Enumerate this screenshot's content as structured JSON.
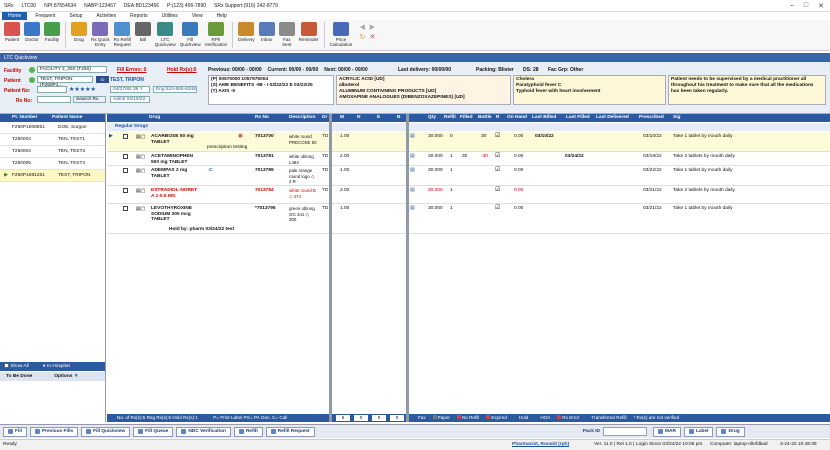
{
  "titlebar": {
    "app": "SRx",
    "store": "LTC00",
    "npi": "NPI:87654634",
    "nabp": "NABP:123467",
    "dea": "DEA:BD123456",
    "phone": "P:(123) 456-7890",
    "support": "SRx Support:(916) 242-8779",
    "min": "–",
    "max": "□",
    "close": "✕"
  },
  "menu": [
    "Home",
    "Frequent",
    "Setup",
    "Activities",
    "Reports",
    "Utilities",
    "View",
    "Help"
  ],
  "ribbon": [
    {
      "label": "Patient",
      "icon": "patient-icon",
      "color": "#d9534f"
    },
    {
      "label": "Doctor",
      "icon": "doctor-icon",
      "color": "#3c78c8"
    },
    {
      "label": "Facility",
      "icon": "facility-icon",
      "color": "#4a9d4a"
    },
    {
      "label": "Drug",
      "icon": "drug-icon",
      "color": "#e0a020"
    },
    {
      "label": "Rx Quick\nEntry",
      "icon": "rx-quick-entry-icon",
      "color": "#7a6bb8"
    },
    {
      "label": "Rx Refill\nRequest",
      "icon": "rx-refill-icon",
      "color": "#4d8fcf"
    },
    {
      "label": "Bill",
      "icon": "bill-icon",
      "color": "#666"
    },
    {
      "label": "LTC\nQuickview",
      "icon": "ltc-quickview-icon",
      "color": "#3a8a8a"
    },
    {
      "label": "Fill\nQuickview",
      "icon": "fill-quickview-icon",
      "color": "#3a7ab8"
    },
    {
      "label": "RPh\nVerification",
      "icon": "verification-icon",
      "color": "#6a9a3a"
    },
    {
      "label": "Delivery",
      "icon": "delivery-icon",
      "color": "#c88a2a"
    },
    {
      "label": "Inbox",
      "icon": "inbox-icon",
      "color": "#5a7ab8"
    },
    {
      "label": "Fax\nSent",
      "icon": "fax-sent-icon",
      "color": "#8a8a8a"
    },
    {
      "label": "Reminder",
      "icon": "reminder-icon",
      "color": "#c85a3a"
    },
    {
      "label": "Price\nCalculation",
      "icon": "price-calculation-icon",
      "color": "#4a6ab8"
    }
  ],
  "window_title": "LTC Quickview",
  "filters": {
    "facility_label": "Facility",
    "facility_value": "FACILITY 2_250 (T250)",
    "fill_errors": "Fill Errors: 0",
    "hold_rxs": "Hold Rx(s):0",
    "patient_label": "Patient",
    "patient_value": "TEST, TRIPON (F250P1...",
    "patient_name": "TEST, TRIPON",
    "patient_no_label": "Patient No:",
    "dob": "04/27/82 39 Y",
    "eng": "Eng 510-555-6346",
    "rx_no_label": "Rx No:",
    "search_rx": "Search Rx",
    "admit": "Admit 03/19/22"
  },
  "summary": {
    "previous": "Previous: 00/00 - 00/00",
    "current": "Current: 00/00 - 00/00",
    "next": "Next: 00/00 - 00/00",
    "last_delivery": "Last delivery:   00/00/00",
    "packing": "Packing: Blister",
    "ds": "DS: 28",
    "fac_grp": "Fac Grp: Other"
  },
  "insurance": [
    "(P) 00670000   1057975004",
    "(S) AME BENEFITS  -98 - I 03/22/22 E 03/22/25",
    "(T) AXIS  -5"
  ],
  "allergies": [
    "ACRYLIC ACID [UD]",
    "albuterol",
    "ALUMINUM CONTAINING PRODUCTS [UD]",
    "AMOXAPINE ANALOGUES (DIBENZOXAZEPINES) [UD]"
  ],
  "conditions": [
    "Cholera",
    "Paratyphoid fever C",
    "Typhoid fever with heart involvement"
  ],
  "note": "Patient needs to be supervised by a medical practitioner all throughout his treatment to make sure that all the medications has been taken regularly.",
  "sidebar": {
    "headers": [
      "Pt. Number",
      "Patient Name"
    ],
    "rows": [
      [
        "F250P1608851",
        "DOE, Surgon"
      ],
      [
        "T250003",
        "TEN, TEST1"
      ],
      [
        "T250004",
        "TEN, TEST3"
      ],
      [
        "T250005",
        "TEN, TEST4"
      ],
      [
        "F250P1681251",
        "TEST, TRIPON"
      ]
    ],
    "show_all": "Show All",
    "in_hospital": "In Hospital",
    "to_be_done": "To Be Done",
    "options": "Options"
  },
  "grid": {
    "headers": {
      "drug": "Drug",
      "rxno": "Rx No",
      "desc": "Description",
      "dr": "Dr",
      "m": "M",
      "n": "N",
      "e": "E",
      "b": "B",
      "qty": "Qty",
      "refill": "Refill",
      "filled": "Filled",
      "bottle": "Bottle",
      "r": "R",
      "onhand": "On Hand",
      "lastbilled": "Last Billed",
      "lastfilled": "Last Filled",
      "lastdelivered": "Last Delivered",
      "prescribed": "Prescribed",
      "sig": "Sig"
    },
    "section": "Regular Drugs",
    "rows": [
      {
        "drug": "ACARBOSE 50 mg\nTABLET",
        "drug_color": "#111",
        "rxno": "7013700",
        "desc": "white round\nPRECOSE 50",
        "dr": "TD",
        "m": "1.00",
        "qty": "30.000",
        "refill": "0",
        "filled": "",
        "bottle": "30",
        "onhand": "0.00",
        "onhand_color": "#111",
        "lastbilled": "03/10/22",
        "lastfilled": "",
        "prescribed": "03/10/22",
        "sig": "Take 1 tablet by mouth daily",
        "extra": "prescription testing"
      },
      {
        "drug": "ACETAMINOPHEN\n500 mg TABLET",
        "drug_color": "#111",
        "rxno": "7013781",
        "desc": "white oblong\nL484",
        "dr": "TD",
        "m": "2.00",
        "qty": "30.000",
        "refill": "1",
        "filled": "30",
        "bottle": "-30",
        "onhand": "0.00",
        "onhand_color": "#111",
        "lastbilled": "",
        "lastfilled": "03/24/22",
        "prescribed": "03/19/22",
        "sig": "Take 2 tablets by mouth daily",
        "extra": ""
      },
      {
        "drug": "ADEMPAS 2 mg\nTABLET",
        "drug_color": "#111",
        "rxno": "7013789",
        "desc": "pale orange\nround logo ◇\n2 R",
        "dr": "TD",
        "m": "1.00",
        "qty": "30.000",
        "refill": "1",
        "filled": "",
        "bottle": "",
        "onhand": "0.00",
        "onhand_color": "#111",
        "lastbilled": "",
        "lastfilled": "",
        "prescribed": "03/22/22",
        "sig": "Take 1 tablet by mouth daily",
        "extra": ""
      },
      {
        "drug": "ESTRADIOL-NORET\nA 1-0.5 MG",
        "drug_color": "#c00",
        "rxno": "7013784",
        "desc": "white round B\n◇ 474",
        "dr": "TD",
        "m": "2.00",
        "qty": "30.000",
        "refill": "1",
        "filled": "",
        "bottle": "",
        "onhand": "0.00",
        "onhand_color": "#c00",
        "lastbilled": "",
        "lastfilled": "",
        "prescribed": "03/21/22",
        "sig": "Take 2 tablets by mouth daily",
        "extra": ""
      },
      {
        "drug": "LEVOTHYROXINE\nSODIUM 300 mcg\nTABLET",
        "drug_color": "#111",
        "rxno": "*7013795",
        "desc": "green oblong\nGG 341 ◇\n300",
        "dr": "TD",
        "m": "1.00",
        "qty": "30.000",
        "refill": "1",
        "filled": "",
        "bottle": "",
        "onhand": "0.00",
        "onhand_color": "#111",
        "lastbilled": "",
        "lastfilled": "",
        "prescribed": "03/21/22",
        "sig": "Take 1 tablet by mouth daily",
        "extra": "Hold by:  pharm  03/24/22  test"
      }
    ],
    "footer_left": "No. of Rx(s):5  Reg Rx(s):5  Hold Rx(s):1",
    "footer_mid": "P= Print Label  PG= PA Gen.  C= Call",
    "footer_totals": [
      "5",
      "0",
      "0",
      "0"
    ],
    "legend": [
      "Fax",
      "Paper",
      "No Refill",
      "Expired",
      "Hold",
      "HOA",
      "Rx Error",
      "Transferred Refill",
      "* Rx(s) are not verified"
    ]
  },
  "bottom_buttons": [
    "Fill",
    "Previous Fills",
    "Fill Quickview",
    "Fill Queue",
    "NDC Verification",
    "Refill",
    "Refill Request"
  ],
  "pack_id_label": "Pack ID",
  "bottom_right_buttons": [
    "MAR",
    "Label",
    "Drug"
  ],
  "status": {
    "left": "Ready",
    "pharmacist": "Pharmacist, Ronald (rph)",
    "version": "Ver. 11.0 | Rel 1.0 |",
    "login": "Login Since 03/24/22 10:06 pm",
    "computer": "Computer: laptop-nllefdkad",
    "datetime": "3-24-22 10:48:39"
  }
}
